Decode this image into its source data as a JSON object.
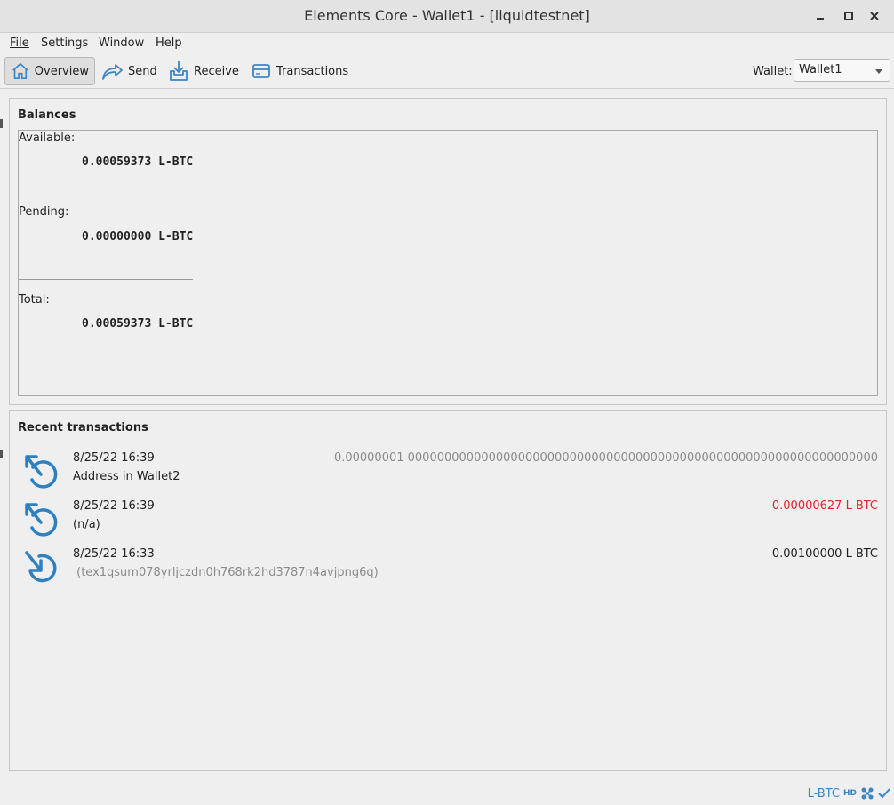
{
  "window": {
    "title": "Elements Core - Wallet1 - [liquidtestnet]"
  },
  "menu": [
    {
      "label": "File"
    },
    {
      "label": "Settings"
    },
    {
      "label": "Window"
    },
    {
      "label": "Help"
    }
  ],
  "toolbar": {
    "overview": "Overview",
    "send": "Send",
    "receive": "Receive",
    "transactions": "Transactions",
    "wallet_label": "Wallet:",
    "wallet_selected": "Wallet1"
  },
  "balances": {
    "title": "Balances",
    "available_label": "Available:",
    "available_value": "0.00059373 L-BTC",
    "pending_label": "Pending:",
    "pending_value": "0.00000000 L-BTC",
    "total_label": "Total:",
    "total_value": "0.00059373 L-BTC"
  },
  "recent": {
    "title": "Recent transactions",
    "items": [
      {
        "date": "8/25/22 16:39",
        "description": "Address in Wallet2",
        "amount": "0.00000001 0000000000000000000000000000000000000000000000000000000000000000",
        "type": "sent"
      },
      {
        "date": "8/25/22 16:39",
        "description": "(n/a)",
        "amount": "-0.00000627 L-BTC",
        "type": "sent"
      },
      {
        "date": "8/25/22 16:33",
        "description": " (tex1qsum078yrljczdn0h768rk2hd3787n4avjpng6q)",
        "amount": "0.00100000 L-BTC",
        "type": "received"
      }
    ]
  },
  "status": {
    "unit": "L-BTC",
    "hd": "HD"
  },
  "colors": {
    "accent": "#3b86c8",
    "negative": "#e8212b",
    "muted": "#8a8a8a"
  }
}
